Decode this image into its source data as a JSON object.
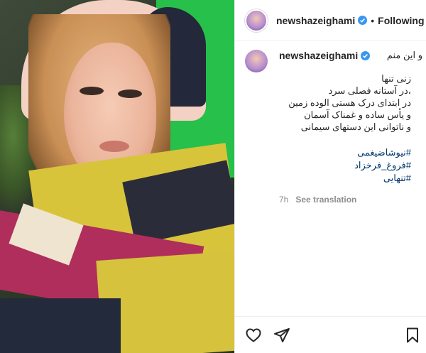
{
  "post": {
    "username": "newshazeighami",
    "follow_status": "Following",
    "dot_separator": "•"
  },
  "caption": {
    "username": "newshazeighami",
    "first_line": "و این منم",
    "lines": [
      "زنی تنها",
      "،در آستانه فصلی سرد",
      "در ابتدای درک هستی الوده زمین",
      "و یأس ساده و غمناک آسمان",
      "و ناتوانی این دستهای سیمانی"
    ],
    "hashtags": [
      "#نیوشاضیغمی",
      "#فروغ_فرخزاد",
      "#تنهایی"
    ],
    "time": "7h",
    "see_translation": "See translation"
  },
  "icons": {
    "verified": "verified-badge-icon",
    "like": "heart-icon",
    "share": "paper-plane-icon",
    "save": "bookmark-icon"
  },
  "colors": {
    "verified_blue": "#3897f0",
    "hashtag_blue": "#00376b",
    "meta_grey": "#8e8e8e"
  }
}
